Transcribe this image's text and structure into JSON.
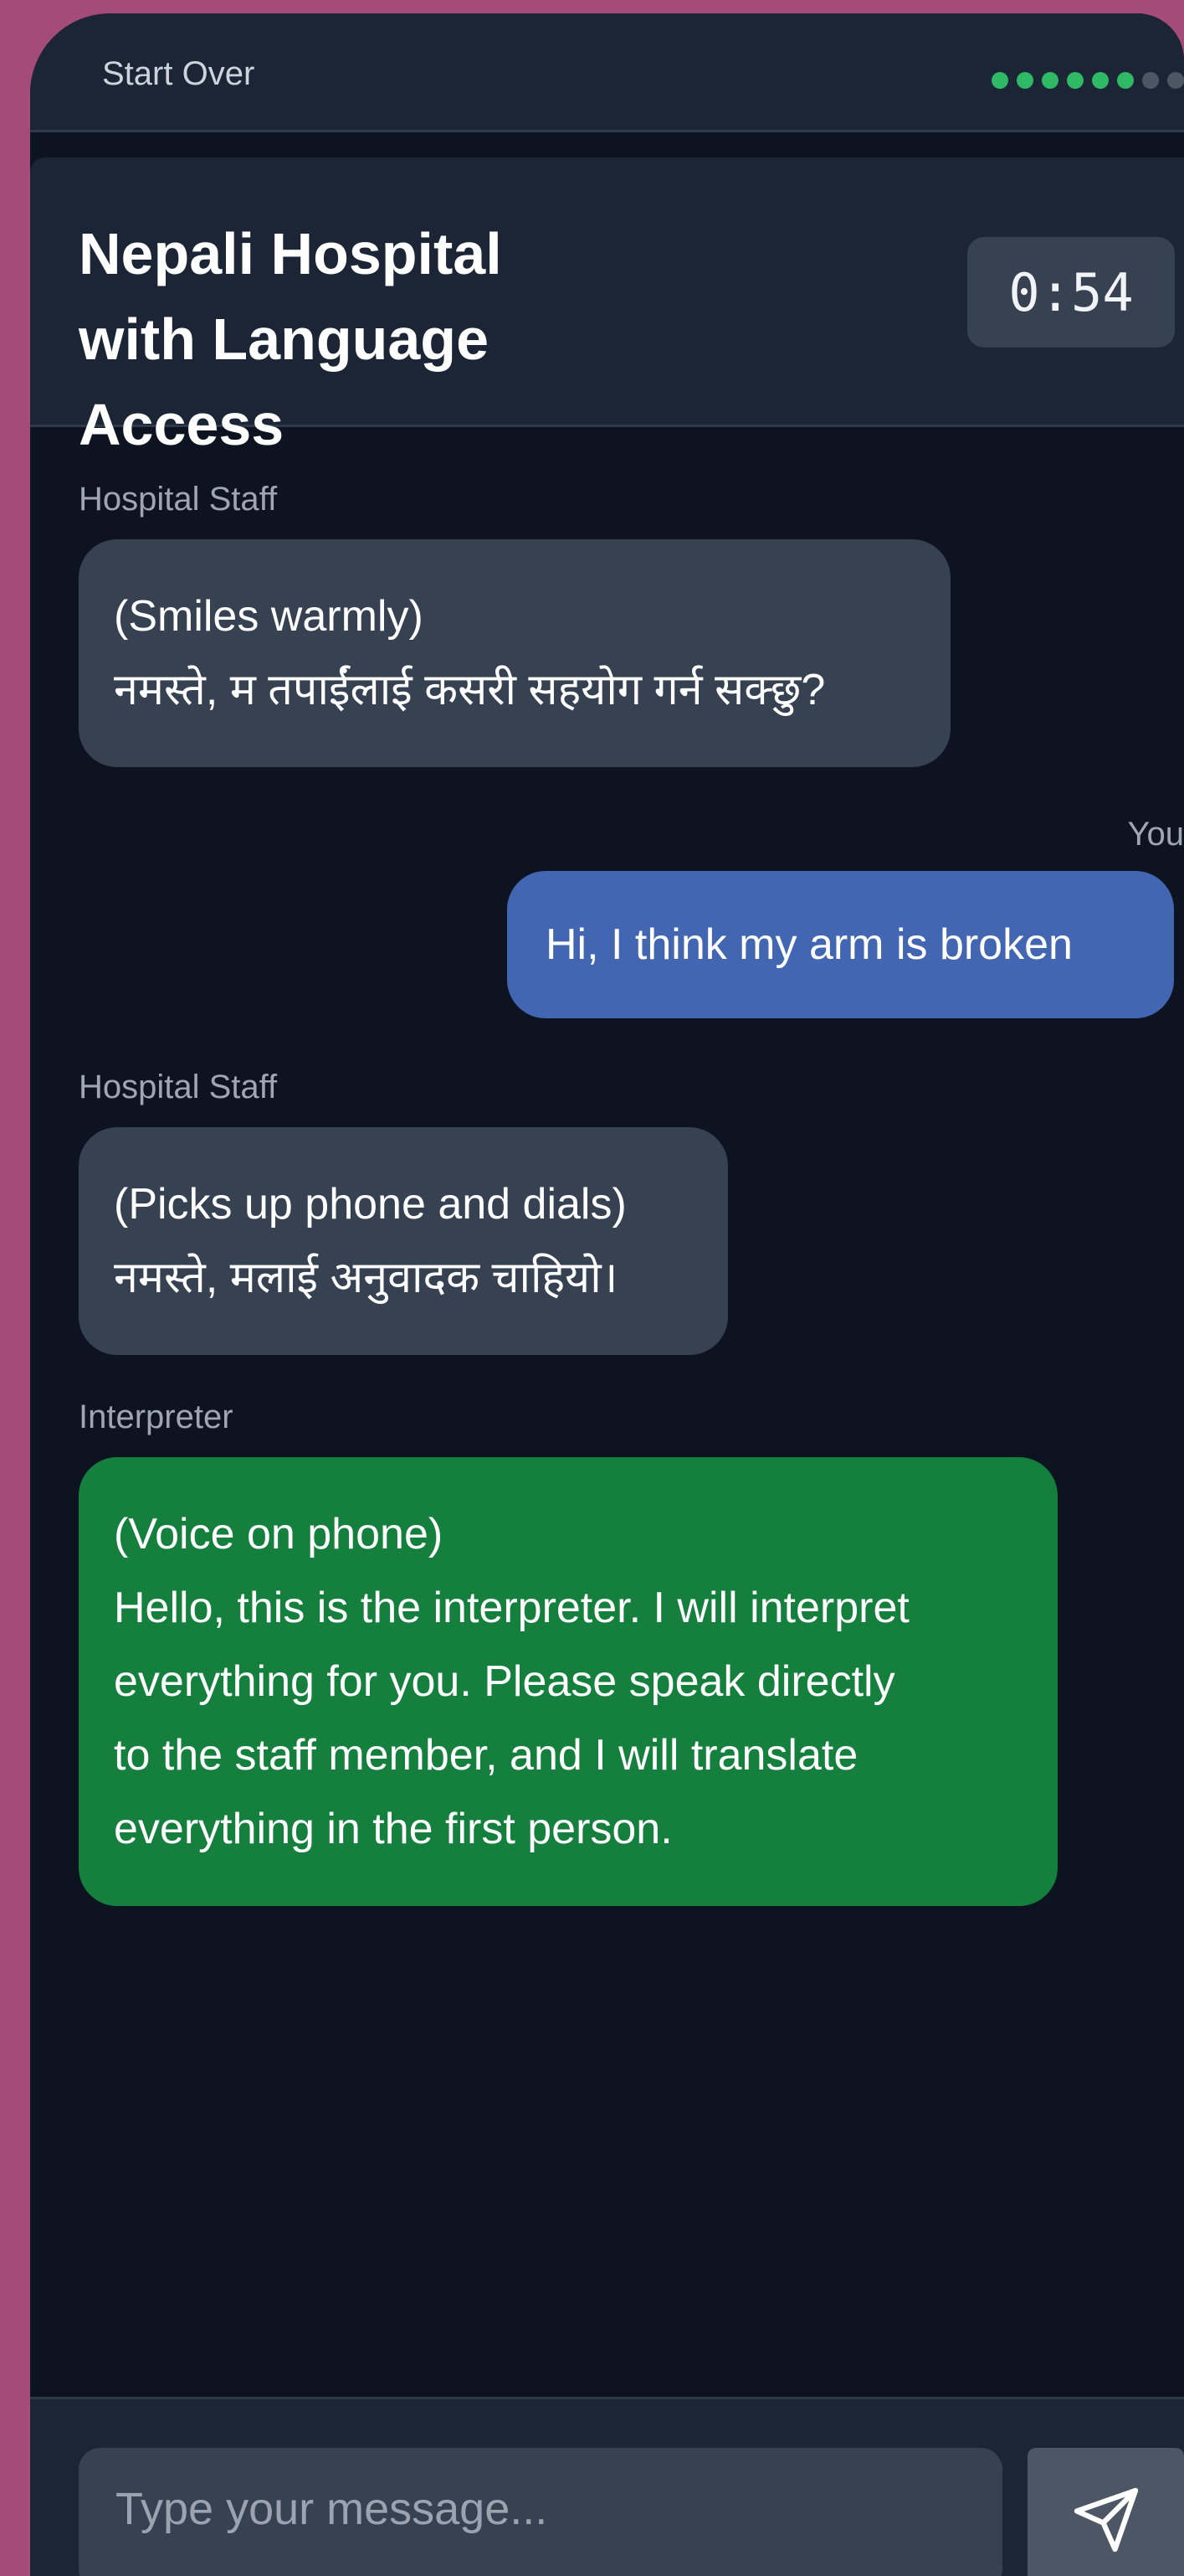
{
  "topbar": {
    "start_over_label": "Start Over",
    "progress": {
      "completed": 6,
      "total": 8
    }
  },
  "header": {
    "title": "Nepali Hospital with Language Access",
    "timer": "0:54"
  },
  "messages": [
    {
      "speaker": "Hospital Staff",
      "text": "(Smiles warmly)\nनमस्ते, म तपाईंलाई कसरी सहयोग गर्न सक्छु?"
    },
    {
      "speaker": "You",
      "text": "Hi, I think my arm is broken"
    },
    {
      "speaker": "Hospital Staff",
      "text": "(Picks up phone and dials)\nनमस्ते, मलाई अनुवादक चाहियो।"
    },
    {
      "speaker": "Interpreter",
      "text": "(Voice on phone)\nHello, this is the interpreter. I will interpret\neverything for you. Please speak directly\nto the staff member, and I will translate\neverything in the first person."
    }
  ],
  "composer": {
    "placeholder": "Type your message...",
    "send_icon": "send-icon"
  },
  "colors": {
    "accent_green": "#15803d",
    "user_bubble": "#4266b1",
    "staff_bubble": "#364152",
    "progress_done": "#2fb865",
    "progress_pending": "#4d5663"
  }
}
